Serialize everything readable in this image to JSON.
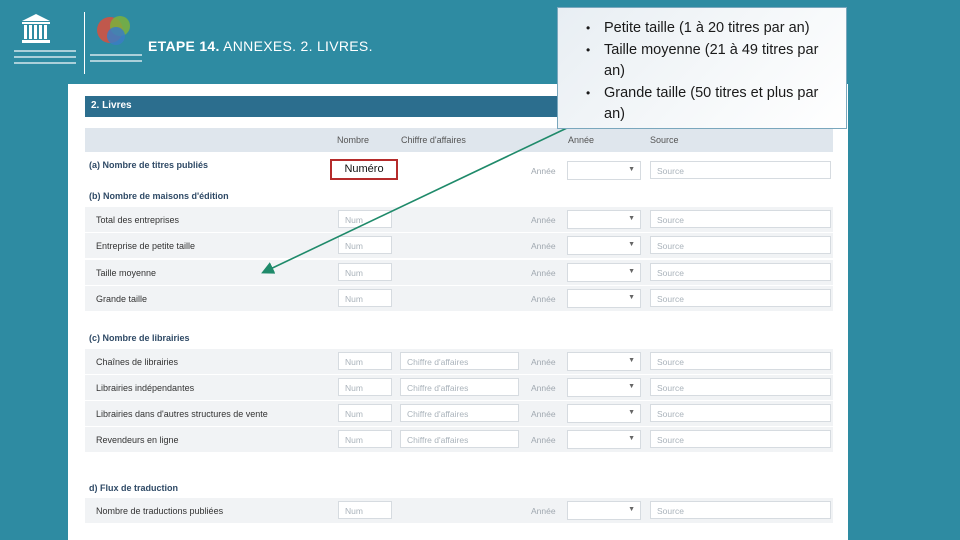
{
  "slide": {
    "title_bold": "ETAPE 14.",
    "title_rest": " ANNEXES. 2. LIVRES.",
    "logo_text_left": "United Nations Educational, Scientific and Cultural Organization",
    "logo_text_right": "Diversity of Cultural Expressions",
    "logo_acronym": "UNESCO"
  },
  "callout": {
    "items": [
      "Petite taille (1 à 20 titres par an)",
      "Taille moyenne (21 à 49 titres par an)",
      "Grande taille (50 titres et plus par an)"
    ]
  },
  "annotation": {
    "label": "Numéro"
  },
  "form": {
    "section_title": "2. Livres",
    "columns": [
      "Nombre",
      "Chiffre d'affaires",
      "Année",
      "Source"
    ],
    "placeholders": {
      "num": "Num",
      "ca": "Chiffre d'affaires",
      "annee": "Année",
      "source": "Source"
    },
    "headings": {
      "a": "(a) Nombre de titres publiés",
      "b": "(b) Nombre de maisons d'édition",
      "c": "(c) Nombre de librairies",
      "d": "d) Flux de traduction"
    },
    "rows_b": [
      "Total des entreprises",
      "Entreprise de petite taille",
      "Taille moyenne",
      "Grande taille"
    ],
    "rows_c": [
      "Chaînes de librairies",
      "Librairies indépendantes",
      "Librairies dans d'autres structures de vente",
      "Revendeurs en ligne"
    ],
    "rows_d": [
      "Nombre de traductions publiées"
    ]
  }
}
